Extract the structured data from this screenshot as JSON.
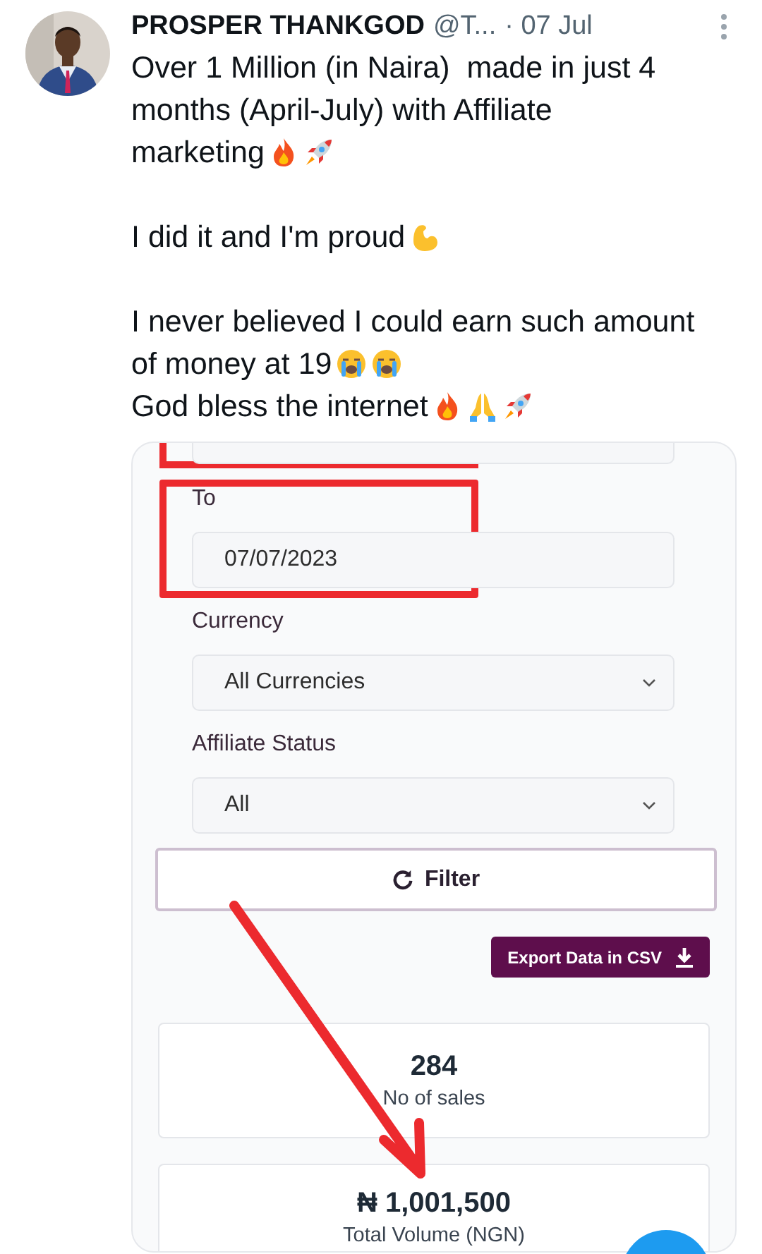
{
  "tweet": {
    "author": "PROSPER THANKGOD",
    "handle": "@T...",
    "date": "· 07 Jul",
    "blocks": [
      {
        "lines": [
          {
            "text": "Over 1 Million (in Naira)  made in just 4"
          },
          {
            "text": "months (April-July) with Affiliate"
          },
          {
            "text": "marketing",
            "emojis": [
              {
                "kind": "fire"
              },
              {
                "kind": "rocket"
              }
            ]
          }
        ]
      },
      {
        "lines": [
          {
            "text": "I did it and I'm proud",
            "emojis": [
              {
                "kind": "muscle"
              }
            ]
          }
        ]
      },
      {
        "lines": [
          {
            "text": "I never believed I could earn such amount"
          },
          {
            "text": "of money at 19",
            "emojis": [
              {
                "kind": "crying"
              },
              {
                "kind": "crying"
              }
            ]
          },
          {
            "text": "God bless the internet",
            "emojis": [
              {
                "kind": "fire"
              },
              {
                "kind": "pray"
              },
              {
                "kind": "rocket"
              }
            ]
          }
        ]
      }
    ]
  },
  "screenshot": {
    "fields": [
      {
        "kind": "cut",
        "highlighted": true
      },
      {
        "kind": "date",
        "label": "To",
        "value": "07/07/2023",
        "highlighted": true
      },
      {
        "kind": "select",
        "label": "Currency",
        "value": "All Currencies",
        "highlighted": false
      },
      {
        "kind": "select",
        "label": "Affiliate Status",
        "value": "All",
        "highlighted": false
      }
    ],
    "filter_button": "Filter",
    "export_button": "Export Data in CSV",
    "stats": [
      {
        "value": "284",
        "label": "No of sales"
      },
      {
        "value": "₦ 1,001,500",
        "label": "Total Volume (NGN)"
      }
    ]
  }
}
